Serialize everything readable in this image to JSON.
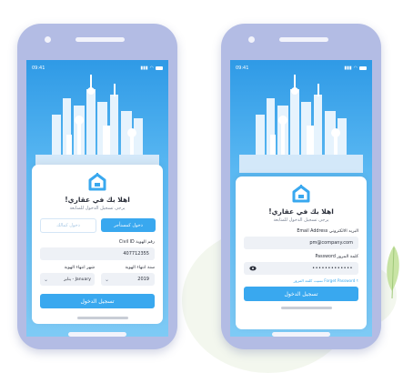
{
  "status_time": "09:41",
  "common": {
    "welcome_title": "اهلا بك في عقاري!",
    "welcome_subtitle": "يرجى تسجيل الدخول للمتابعة",
    "login_button": "تسجيل الدخول"
  },
  "left_screen": {
    "tab_tenant": "دخول كمستأجر",
    "tab_owner": "دخول كمالك",
    "civil_id_label": "رقم الهوية Civil ID",
    "civil_id_value": "407712355",
    "expiry_year_label": "سنة انتهاء الهوية",
    "expiry_year_value": "2019",
    "expiry_month_label": "شهر انتهاء الهوية",
    "expiry_month_value": "يناير - January"
  },
  "right_screen": {
    "email_label": "البريد الالكتروني Email Address",
    "email_value": "pm@company.com",
    "password_label": "كلمة المرور Password",
    "password_value": "•••••••••••••",
    "forgot_password": "نسيت كلمة المرور Forget Password ؟"
  },
  "colors": {
    "accent": "#39a8ef",
    "phone_frame": "#b3bce4",
    "screen_top": "#2f9ae6"
  },
  "icons": {
    "logo": "house-logo-icon",
    "eye": "eye-icon",
    "chevron": "chevron-down-icon"
  }
}
